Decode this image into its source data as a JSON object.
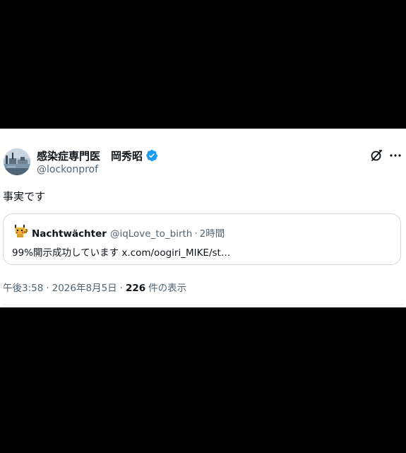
{
  "tweet": {
    "author": {
      "display_name": "感染症専門医　岡秀昭",
      "handle": "@lockonprof",
      "verified": true,
      "avatar_icon": "profile-photo-icon"
    },
    "text": "事実です",
    "quote": {
      "author_name": "Nachtwächter",
      "author_handle": "@iqLove_to_birth",
      "separator": "·",
      "time": "2時間",
      "text": "99%開示成功しています x.com/oogiri_MIKE/st…",
      "avatar_icon": "pixel-pikachu-icon"
    },
    "meta": {
      "time": "午後3:58",
      "date": "2026年8月5日",
      "separator": "·",
      "views_count": "226",
      "views_label": "件の表示"
    }
  },
  "icons": {
    "verified": "verified-badge-icon",
    "grok": "grok-icon",
    "more": "more-options-icon"
  },
  "colors": {
    "verified_blue": "#1d9bf0",
    "text_primary": "#0f1419",
    "text_secondary": "#536471",
    "border": "#cfd9de",
    "background_outer": "#000000",
    "card_background": "#ffffff"
  }
}
